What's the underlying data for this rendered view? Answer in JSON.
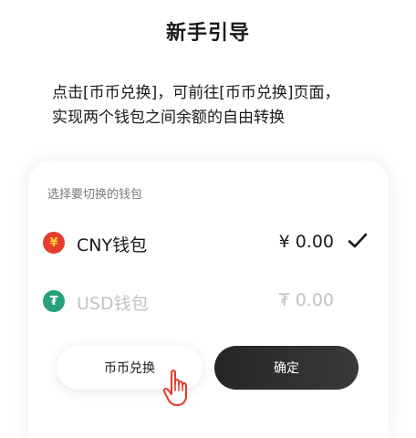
{
  "title": "新手引导",
  "description": {
    "line1": "点击[币币兑换]，可前往[币币兑换]页面，",
    "line2": "实现两个钱包之间余额的自由转换"
  },
  "wallet_picker": {
    "hint": "选择要切换的钱包",
    "wallets": [
      {
        "icon": "yuan-coin-icon",
        "symbol": "¥",
        "name": "CNY钱包",
        "amount": "¥ 0.00",
        "selected": true,
        "color": "#e63d2c"
      },
      {
        "icon": "tether-coin-icon",
        "symbol": "₮",
        "name": "USD钱包",
        "amount": "₮ 0.00",
        "selected": false,
        "color": "#26a17b"
      }
    ]
  },
  "buttons": {
    "exchange": "币币兑换",
    "confirm": "确定"
  }
}
